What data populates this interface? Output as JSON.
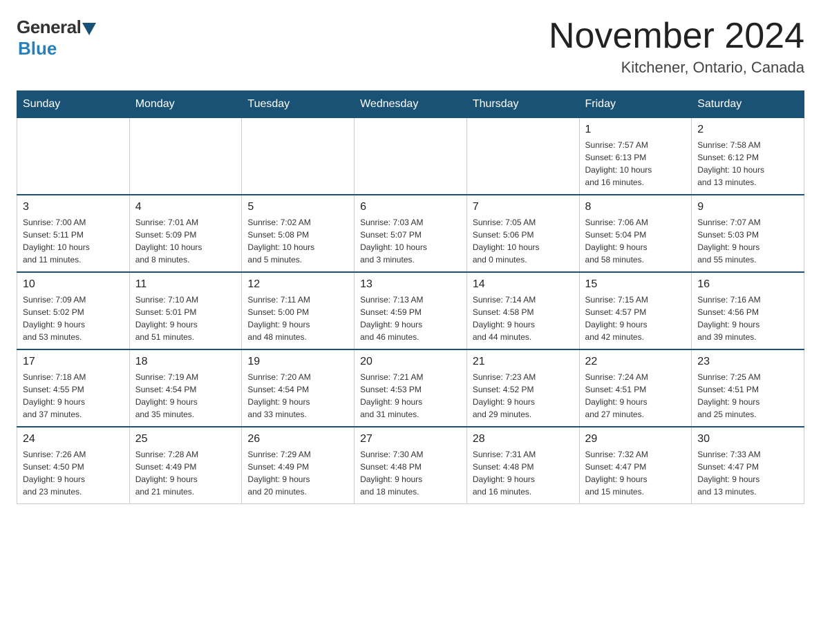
{
  "logo": {
    "general": "General",
    "blue": "Blue",
    "subtitle": "Blue"
  },
  "title": "November 2024",
  "subtitle": "Kitchener, Ontario, Canada",
  "headers": [
    "Sunday",
    "Monday",
    "Tuesday",
    "Wednesday",
    "Thursday",
    "Friday",
    "Saturday"
  ],
  "weeks": [
    [
      {
        "day": "",
        "info": ""
      },
      {
        "day": "",
        "info": ""
      },
      {
        "day": "",
        "info": ""
      },
      {
        "day": "",
        "info": ""
      },
      {
        "day": "",
        "info": ""
      },
      {
        "day": "1",
        "info": "Sunrise: 7:57 AM\nSunset: 6:13 PM\nDaylight: 10 hours\nand 16 minutes."
      },
      {
        "day": "2",
        "info": "Sunrise: 7:58 AM\nSunset: 6:12 PM\nDaylight: 10 hours\nand 13 minutes."
      }
    ],
    [
      {
        "day": "3",
        "info": "Sunrise: 7:00 AM\nSunset: 5:11 PM\nDaylight: 10 hours\nand 11 minutes."
      },
      {
        "day": "4",
        "info": "Sunrise: 7:01 AM\nSunset: 5:09 PM\nDaylight: 10 hours\nand 8 minutes."
      },
      {
        "day": "5",
        "info": "Sunrise: 7:02 AM\nSunset: 5:08 PM\nDaylight: 10 hours\nand 5 minutes."
      },
      {
        "day": "6",
        "info": "Sunrise: 7:03 AM\nSunset: 5:07 PM\nDaylight: 10 hours\nand 3 minutes."
      },
      {
        "day": "7",
        "info": "Sunrise: 7:05 AM\nSunset: 5:06 PM\nDaylight: 10 hours\nand 0 minutes."
      },
      {
        "day": "8",
        "info": "Sunrise: 7:06 AM\nSunset: 5:04 PM\nDaylight: 9 hours\nand 58 minutes."
      },
      {
        "day": "9",
        "info": "Sunrise: 7:07 AM\nSunset: 5:03 PM\nDaylight: 9 hours\nand 55 minutes."
      }
    ],
    [
      {
        "day": "10",
        "info": "Sunrise: 7:09 AM\nSunset: 5:02 PM\nDaylight: 9 hours\nand 53 minutes."
      },
      {
        "day": "11",
        "info": "Sunrise: 7:10 AM\nSunset: 5:01 PM\nDaylight: 9 hours\nand 51 minutes."
      },
      {
        "day": "12",
        "info": "Sunrise: 7:11 AM\nSunset: 5:00 PM\nDaylight: 9 hours\nand 48 minutes."
      },
      {
        "day": "13",
        "info": "Sunrise: 7:13 AM\nSunset: 4:59 PM\nDaylight: 9 hours\nand 46 minutes."
      },
      {
        "day": "14",
        "info": "Sunrise: 7:14 AM\nSunset: 4:58 PM\nDaylight: 9 hours\nand 44 minutes."
      },
      {
        "day": "15",
        "info": "Sunrise: 7:15 AM\nSunset: 4:57 PM\nDaylight: 9 hours\nand 42 minutes."
      },
      {
        "day": "16",
        "info": "Sunrise: 7:16 AM\nSunset: 4:56 PM\nDaylight: 9 hours\nand 39 minutes."
      }
    ],
    [
      {
        "day": "17",
        "info": "Sunrise: 7:18 AM\nSunset: 4:55 PM\nDaylight: 9 hours\nand 37 minutes."
      },
      {
        "day": "18",
        "info": "Sunrise: 7:19 AM\nSunset: 4:54 PM\nDaylight: 9 hours\nand 35 minutes."
      },
      {
        "day": "19",
        "info": "Sunrise: 7:20 AM\nSunset: 4:54 PM\nDaylight: 9 hours\nand 33 minutes."
      },
      {
        "day": "20",
        "info": "Sunrise: 7:21 AM\nSunset: 4:53 PM\nDaylight: 9 hours\nand 31 minutes."
      },
      {
        "day": "21",
        "info": "Sunrise: 7:23 AM\nSunset: 4:52 PM\nDaylight: 9 hours\nand 29 minutes."
      },
      {
        "day": "22",
        "info": "Sunrise: 7:24 AM\nSunset: 4:51 PM\nDaylight: 9 hours\nand 27 minutes."
      },
      {
        "day": "23",
        "info": "Sunrise: 7:25 AM\nSunset: 4:51 PM\nDaylight: 9 hours\nand 25 minutes."
      }
    ],
    [
      {
        "day": "24",
        "info": "Sunrise: 7:26 AM\nSunset: 4:50 PM\nDaylight: 9 hours\nand 23 minutes."
      },
      {
        "day": "25",
        "info": "Sunrise: 7:28 AM\nSunset: 4:49 PM\nDaylight: 9 hours\nand 21 minutes."
      },
      {
        "day": "26",
        "info": "Sunrise: 7:29 AM\nSunset: 4:49 PM\nDaylight: 9 hours\nand 20 minutes."
      },
      {
        "day": "27",
        "info": "Sunrise: 7:30 AM\nSunset: 4:48 PM\nDaylight: 9 hours\nand 18 minutes."
      },
      {
        "day": "28",
        "info": "Sunrise: 7:31 AM\nSunset: 4:48 PM\nDaylight: 9 hours\nand 16 minutes."
      },
      {
        "day": "29",
        "info": "Sunrise: 7:32 AM\nSunset: 4:47 PM\nDaylight: 9 hours\nand 15 minutes."
      },
      {
        "day": "30",
        "info": "Sunrise: 7:33 AM\nSunset: 4:47 PM\nDaylight: 9 hours\nand 13 minutes."
      }
    ]
  ]
}
